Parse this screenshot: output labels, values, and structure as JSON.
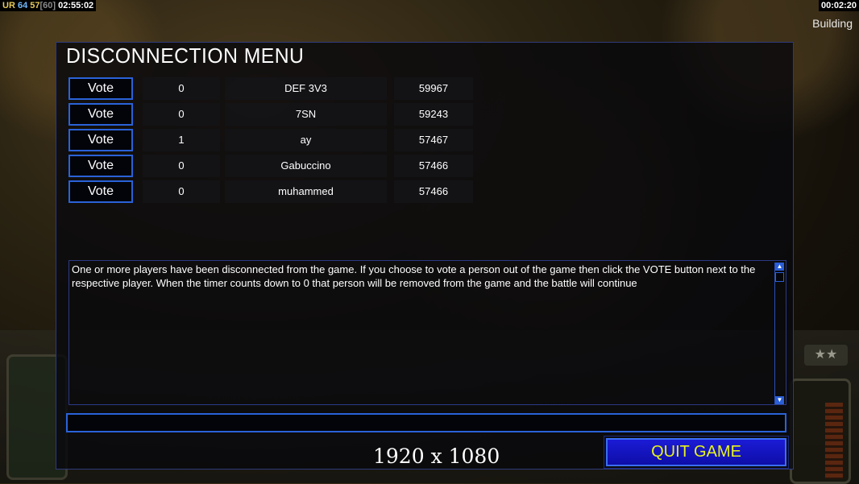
{
  "status_left": {
    "ur": "UR",
    "val_a": "64",
    "val_b": "57",
    "val_c": "[60]",
    "time": "02:55:02"
  },
  "status_right": {
    "time": "00:02:20",
    "mode": "Building"
  },
  "hud": {
    "stars": "★★"
  },
  "dialog": {
    "title": "DISCONNECTION MENU",
    "players": [
      {
        "vote_label": "Vote",
        "votes": "0",
        "name": "DEF 3V3",
        "ping": "59967"
      },
      {
        "vote_label": "Vote",
        "votes": "0",
        "name": "7SN",
        "ping": "59243"
      },
      {
        "vote_label": "Vote",
        "votes": "1",
        "name": "ay",
        "ping": "57467"
      },
      {
        "vote_label": "Vote",
        "votes": "0",
        "name": "Gabuccino",
        "ping": "57466"
      },
      {
        "vote_label": "Vote",
        "votes": "0",
        "name": "muhammed",
        "ping": "57466"
      }
    ],
    "message": "One or more players have been disconnected from the game. If you choose to vote a person out of the game then click the VOTE button next to the respective player. When the timer counts down to 0 that person will be removed from the game and the battle will continue",
    "chat_value": "",
    "quit_label": "QUIT GAME"
  },
  "overlay": {
    "resolution": "1920 x 1080"
  },
  "colors": {
    "accent_blue": "#2a62d8",
    "quit_text": "#e6f21e",
    "quit_bg": "#1b1bd6"
  }
}
